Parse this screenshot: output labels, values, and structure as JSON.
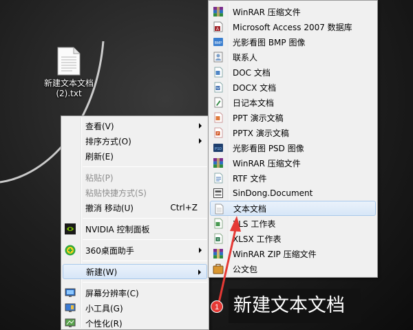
{
  "desktop": {
    "file": {
      "name": "新建文本文档\n(2).txt"
    }
  },
  "context_menu": {
    "items": [
      {
        "label": "查看(V)",
        "submenu": true
      },
      {
        "label": "排序方式(O)",
        "submenu": true
      },
      {
        "label": "刷新(E)"
      },
      {
        "label": "粘贴(P)",
        "disabled": true
      },
      {
        "label": "粘贴快捷方式(S)",
        "disabled": true
      },
      {
        "label": "撤消 移动(U)",
        "shortcut": "Ctrl+Z"
      },
      {
        "label": "NVIDIA 控制面板",
        "icon": "nvidia-icon"
      },
      {
        "label": "360桌面助手",
        "icon": "360-assistant-icon",
        "submenu": true
      },
      {
        "label": "新建(W)",
        "submenu": true,
        "highlighted": true
      },
      {
        "label": "屏幕分辨率(C)",
        "icon": "display-icon"
      },
      {
        "label": "小工具(G)",
        "icon": "gadgets-icon"
      },
      {
        "label": "个性化(R)",
        "icon": "personalize-icon"
      }
    ]
  },
  "new_submenu": {
    "items": [
      {
        "label": "WinRAR 压缩文件",
        "icon": "winrar-icon"
      },
      {
        "label": "Microsoft Access 2007 数据库",
        "icon": "access-icon"
      },
      {
        "label": "光影看图 BMP 图像",
        "icon": "bmp-icon"
      },
      {
        "label": "联系人",
        "icon": "contact-icon"
      },
      {
        "label": "DOC 文档",
        "icon": "doc-icon"
      },
      {
        "label": "DOCX 文档",
        "icon": "docx-icon"
      },
      {
        "label": "日记本文档",
        "icon": "journal-icon"
      },
      {
        "label": "PPT 演示文稿",
        "icon": "ppt-icon"
      },
      {
        "label": "PPTX 演示文稿",
        "icon": "pptx-icon"
      },
      {
        "label": "光影看图 PSD 图像",
        "icon": "psd-icon"
      },
      {
        "label": "WinRAR 压缩文件",
        "icon": "winrar-icon"
      },
      {
        "label": "RTF 文件",
        "icon": "rtf-icon"
      },
      {
        "label": "SinDong.Document",
        "icon": "sindong-icon"
      },
      {
        "label": "文本文档",
        "icon": "text-document-icon",
        "highlighted": true
      },
      {
        "label": "XLS 工作表",
        "icon": "xls-icon"
      },
      {
        "label": "XLSX 工作表",
        "icon": "xlsx-icon"
      },
      {
        "label": "WinRAR ZIP 压缩文件",
        "icon": "winrar-zip-icon"
      },
      {
        "label": "公文包",
        "icon": "briefcase-icon"
      }
    ]
  },
  "annotation": {
    "step": "1",
    "text": "新建文本文档",
    "color": "#e53935"
  }
}
